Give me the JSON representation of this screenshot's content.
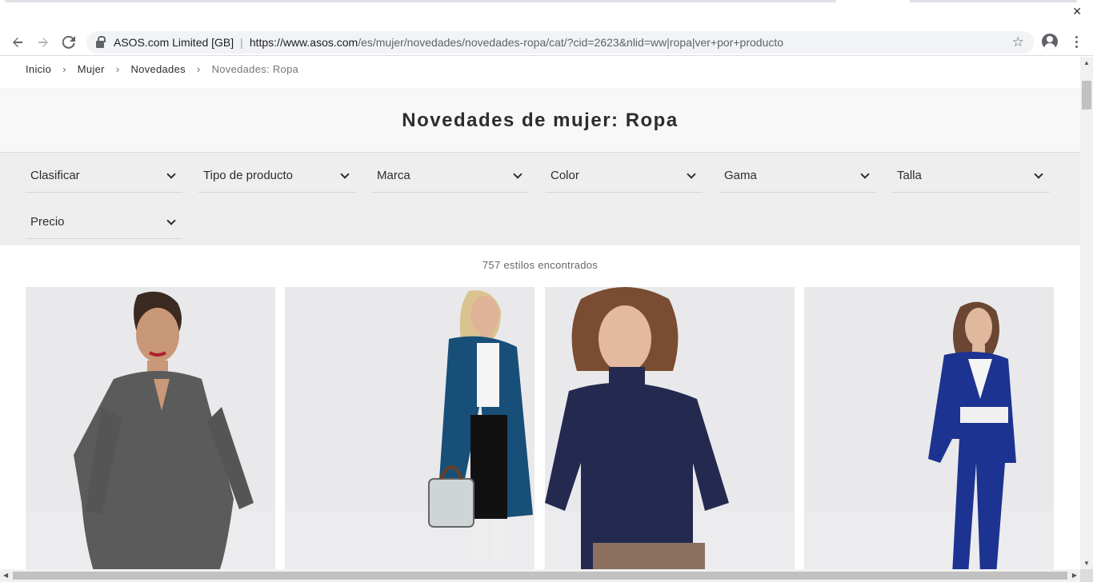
{
  "browser": {
    "site_owner": "ASOS.com Limited [GB]",
    "url_host": "https://www.asos.com",
    "url_path": "/es/mujer/novedades/novedades-ropa/cat/?cid=2623&nlid=ww|ropa|ver+por+producto",
    "back_icon": "arrow-left-icon",
    "forward_icon": "arrow-right-icon",
    "reload_icon": "reload-icon",
    "bookmark_icon": "star-icon"
  },
  "breadcrumb": {
    "items": [
      "Inicio",
      "Mujer",
      "Novedades"
    ],
    "current": "Novedades: Ropa",
    "separator": "›"
  },
  "hero": {
    "title": "Novedades de mujer: Ropa"
  },
  "filters": [
    "Clasificar",
    "Tipo de producto",
    "Marca",
    "Color",
    "Gama",
    "Talla",
    "Precio"
  ],
  "results": {
    "count_text": "757 estilos encontrados"
  },
  "products": [
    {
      "alt": "grey blazer dress",
      "garment_color": "#5b5b5b"
    },
    {
      "alt": "blue faux fur coat",
      "garment_color": "#184f78"
    },
    {
      "alt": "navy knit jumper",
      "garment_color": "#242a4f"
    },
    {
      "alt": "cobalt suit",
      "garment_color": "#1d3391"
    }
  ]
}
